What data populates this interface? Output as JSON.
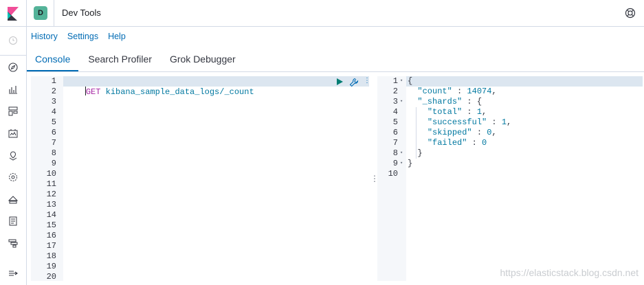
{
  "header": {
    "space_initial": "D",
    "title": "Dev Tools",
    "space_color": "#54b399"
  },
  "leftnav": {
    "icons": [
      "clock-icon",
      "compass-icon",
      "visualize-icon",
      "dashboard-icon",
      "canvas-icon",
      "maps-icon",
      "ml-icon",
      "infrastructure-icon",
      "logs-icon",
      "apm-icon",
      "collapse-nav-icon"
    ]
  },
  "toplinks": {
    "history": "History",
    "settings": "Settings",
    "help": "Help"
  },
  "tabs": [
    {
      "label": "Console",
      "active": true
    },
    {
      "label": "Search Profiler",
      "active": false
    },
    {
      "label": "Grok Debugger",
      "active": false
    }
  ],
  "request": {
    "method": "GET",
    "path": "kibana_sample_data_logs/_count",
    "line_numbers": [
      "1",
      "2",
      "3",
      "4",
      "5",
      "6",
      "7",
      "8",
      "9",
      "10",
      "11",
      "12",
      "13",
      "14",
      "15",
      "16",
      "17",
      "18",
      "19",
      "20"
    ]
  },
  "response": {
    "line_numbers": [
      "1",
      "2",
      "3",
      "4",
      "5",
      "6",
      "7",
      "8",
      "9",
      "10"
    ],
    "lines": [
      "{",
      "  \"count\" : 14074,",
      "  \"_shards\" : {",
      "    \"total\" : 1,",
      "    \"successful\" : 1,",
      "    \"skipped\" : 0,",
      "    \"failed\" : 0",
      "  }",
      "}",
      ""
    ],
    "foldable_lines": [
      1,
      3,
      8,
      9
    ]
  },
  "watermark": "https://elasticstack.blog.csdn.net",
  "colors": {
    "accent": "#006bb4",
    "run": "#017d73",
    "border": "#d3dae6"
  }
}
